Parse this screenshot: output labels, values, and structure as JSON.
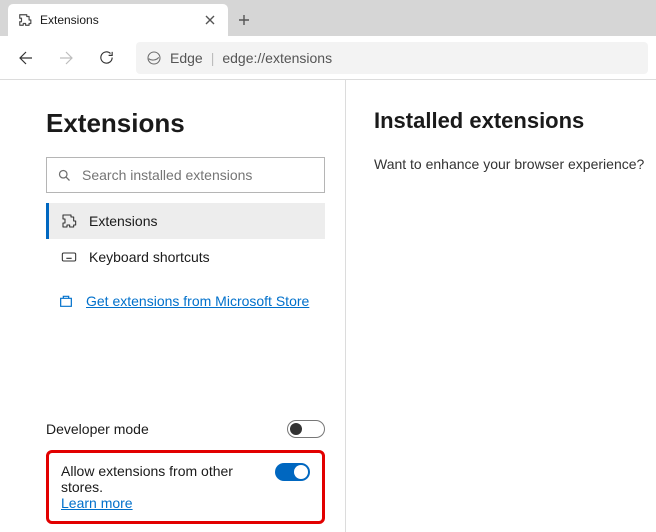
{
  "tab": {
    "title": "Extensions"
  },
  "addressbar": {
    "brand": "Edge",
    "url": "edge://extensions"
  },
  "sidebar": {
    "title": "Extensions",
    "search_placeholder": "Search installed extensions",
    "nav": [
      {
        "label": "Extensions"
      },
      {
        "label": "Keyboard shortcuts"
      }
    ],
    "store_link": "Get extensions from Microsoft Store",
    "dev_mode_label": "Developer mode",
    "other_stores_label": "Allow extensions from other stores.",
    "learn_more": "Learn more"
  },
  "main": {
    "heading": "Installed extensions",
    "prompt": "Want to enhance your browser experience?"
  },
  "toggles": {
    "dev_mode": false,
    "other_stores": true
  }
}
